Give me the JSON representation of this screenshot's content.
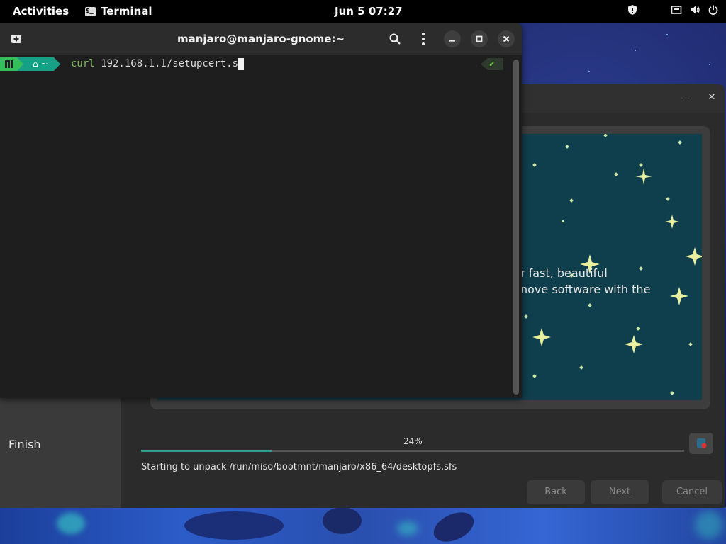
{
  "topbar": {
    "activities": "Activities",
    "app_name": "Terminal",
    "clock": "Jun 5  07:27"
  },
  "terminal": {
    "title": "manjaro@manjaro-gnome:~",
    "prompt_dir": "~",
    "command_name": "curl",
    "command_args": " 192.168.1.1/setupcert.s",
    "status_mark": "✔"
  },
  "installer": {
    "sidebar_items": [
      "Finish"
    ],
    "slide_text": [
      "r fast, beautiful",
      "nove software with the"
    ],
    "progress_percent": 24,
    "progress_label": "24%",
    "status_text": "Starting to unpack /run/miso/bootmnt/manjaro/x86_64/desktopfs.sfs",
    "buttons": {
      "back": "Back",
      "next": "Next",
      "cancel": "Cancel"
    }
  },
  "colors": {
    "accent": "#26a38c",
    "slide_bg": "#0f3e4d",
    "prompt_logo": "#35bf5c",
    "prompt_dir_bg": "#16a085"
  }
}
